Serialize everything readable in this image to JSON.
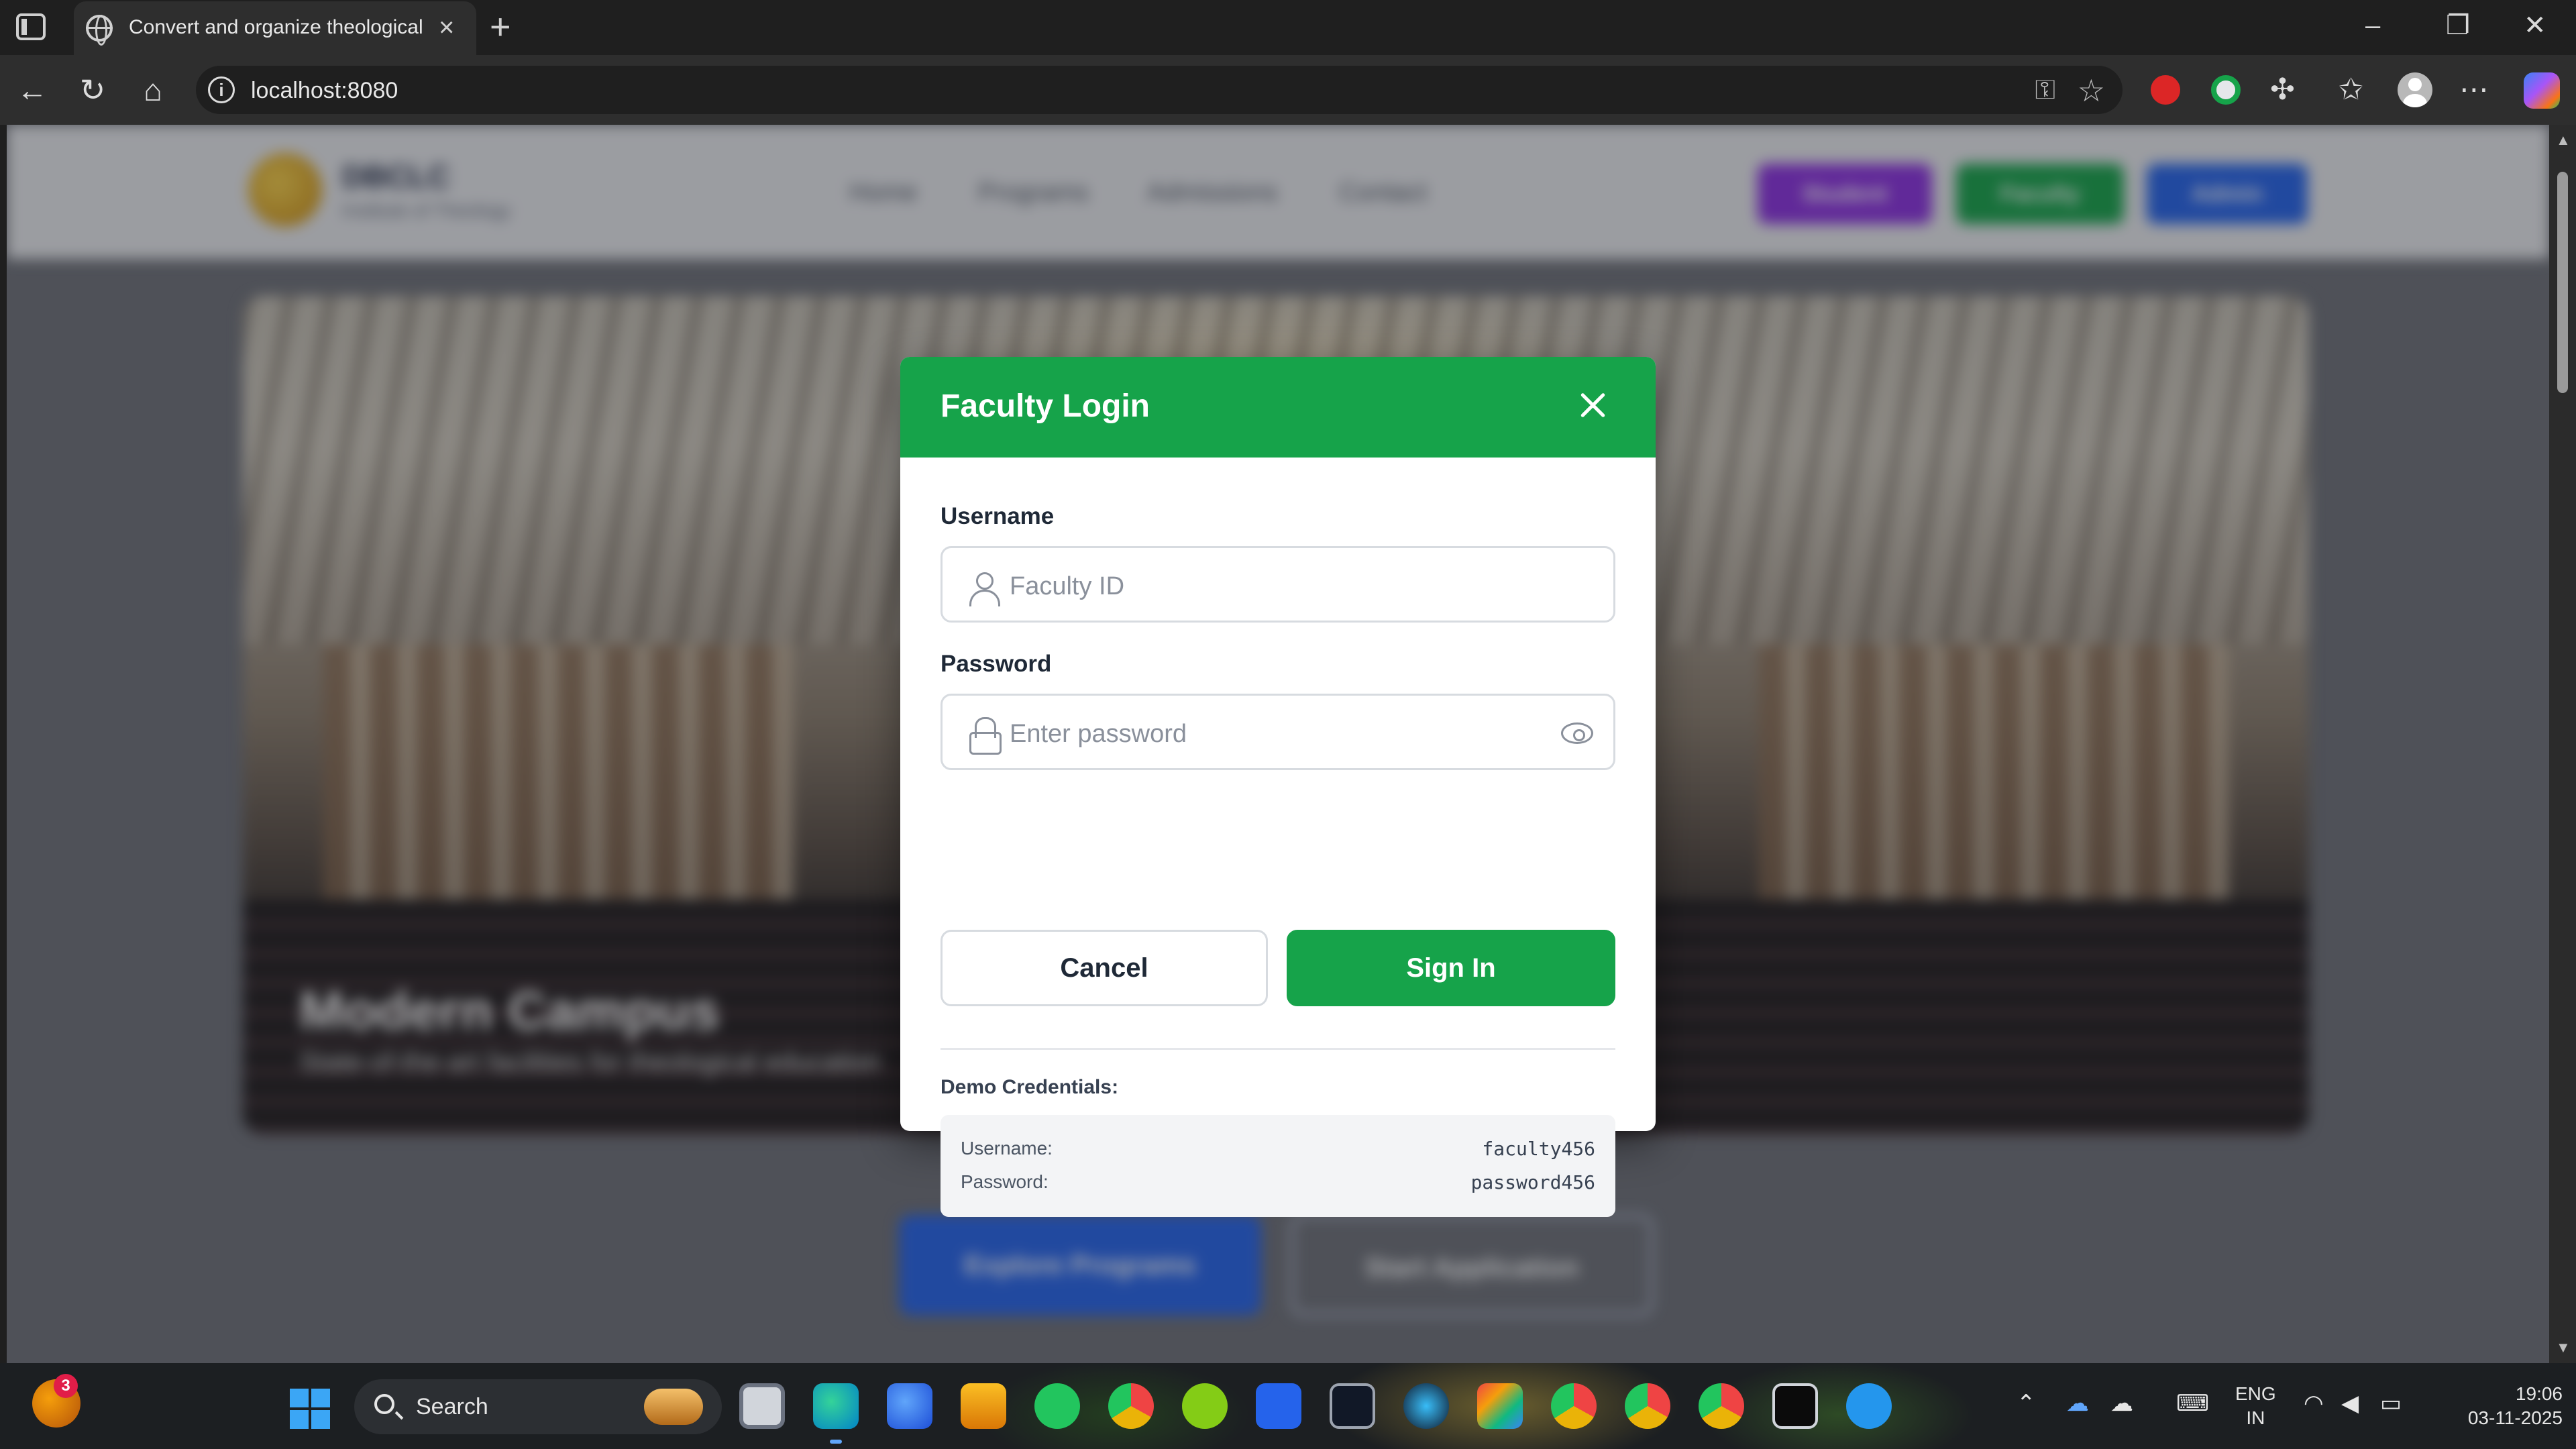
{
  "browser": {
    "tab_title": "Convert and organize theological",
    "tab_close": "×",
    "new_tab": "+",
    "url": "localhost:8080",
    "win_minimize": "–",
    "win_maximize": "❐",
    "win_close": "✕"
  },
  "site": {
    "brand_name": "DBCLC",
    "brand_sub": "Institute of Theology",
    "nav": [
      "Home",
      "Programs",
      "Admissions",
      "Contact"
    ],
    "header_buttons": [
      {
        "label": "Student",
        "color": "#8b2fe0"
      },
      {
        "label": "Faculty",
        "color": "#16a34a"
      },
      {
        "label": "Admin",
        "color": "#2563eb"
      }
    ],
    "hero_title": "Modern Campus",
    "hero_subtitle": "State-of-the-art facilities for theological education",
    "cta_primary": "Explore Programs",
    "cta_secondary": "Start Application",
    "cta_primary_color": "#2563eb"
  },
  "modal": {
    "title": "Faculty Login",
    "header_color": "#16a34a",
    "username_label": "Username",
    "username_placeholder": "Faculty ID",
    "password_label": "Password",
    "password_placeholder": "Enter password",
    "cancel_label": "Cancel",
    "signin_label": "Sign In",
    "demo_title": "Demo Credentials:",
    "demo_username_key": "Username:",
    "demo_username_value": "faculty456",
    "demo_password_key": "Password:",
    "demo_password_value": "password456"
  },
  "taskbar": {
    "weather_badge": "3",
    "search_label": "Search",
    "lang_top": "ENG",
    "lang_bottom": "IN",
    "time": "19:06",
    "date": "03-11-2025"
  }
}
